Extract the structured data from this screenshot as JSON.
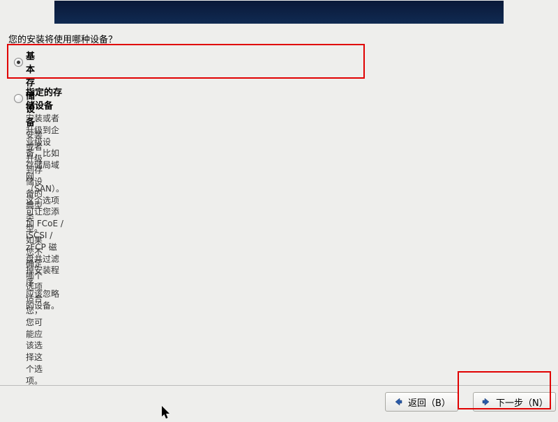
{
  "question": "您的安装将使用哪种设备？",
  "options": {
    "basic": {
      "title": "基本存储设备",
      "desc": "安装或者升级到存储设备的典型类型。如果您不确定哪个选项适合您，您可能应该选择这个选项。",
      "selected": true
    },
    "specified": {
      "title": "指定的存储设备",
      "desc": "安装或者升级到企业级设备，比如存储局域网（SAN）。这个选项可让您添加 FCoE / iSCSI / zFCP 磁盘并过滤掉安装程序\n应该忽略的设备。",
      "selected": false
    }
  },
  "buttons": {
    "back": "返回（B）",
    "next": "下一步（N）"
  }
}
